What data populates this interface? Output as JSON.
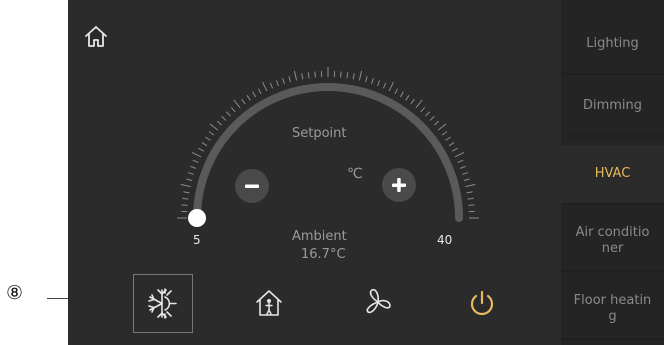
{
  "callout": {
    "number": "⑧"
  },
  "sidebar": {
    "items": [
      {
        "label": "Lighting",
        "active": false
      },
      {
        "label": "Dimming",
        "active": false
      },
      {
        "label": "HVAC",
        "active": true
      },
      {
        "label": "Air conditioner",
        "line1": "Air conditio",
        "line2": "ner",
        "active": false
      },
      {
        "label": "Floor heating",
        "line1": "Floor heatin",
        "line2": "g",
        "active": false
      }
    ]
  },
  "thermostat": {
    "setpoint_label": "Setpoint",
    "unit": "℃",
    "ambient_label": "Ambient",
    "ambient_value": "16.7°C",
    "min": "5",
    "max": "40",
    "setpoint_fraction": 0.0
  },
  "bottom_bar": {
    "icons": [
      "snowflake-sun-icon",
      "home-person-icon",
      "fan-icon",
      "power-icon"
    ]
  },
  "colors": {
    "background": "#2b2b2b",
    "sidebar": "#242424",
    "accent": "#e7b95d",
    "track": "#5a5a5a",
    "text_muted": "#9a9a9a"
  }
}
